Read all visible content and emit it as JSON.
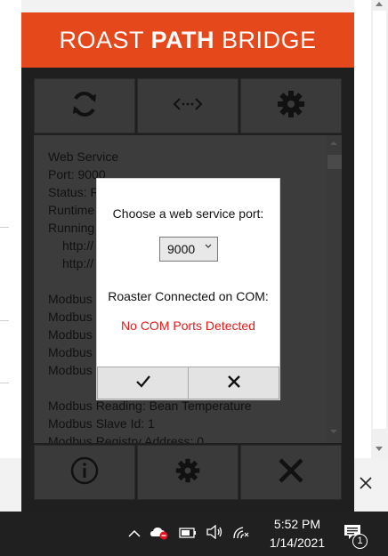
{
  "header": {
    "title_part1": "ROAST ",
    "title_part2": "PATH",
    "title_part3": " BRIDGE"
  },
  "toolbar": {
    "refresh_icon": "refresh-icon",
    "code_icon": "code-icon",
    "settings_icon": "gear-icon"
  },
  "status_lines": [
    "Web Service",
    "Port: 9000",
    "Status: R",
    "Runtime",
    "Running",
    "http://",
    "http://",
    "",
    "Modbus",
    "Modbus",
    "Modbus",
    "Modbus",
    "Modbus",
    "",
    "Modbus Reading: Bean Temperature",
    "Modbus Slave Id: 1",
    "Modbus Registry Address: 0"
  ],
  "dialog": {
    "prompt": "Choose a web service port:",
    "port_value": "9000",
    "roaster_label": "Roaster Connected on COM:",
    "error_text": "No COM Ports Detected",
    "ok_icon": "checkmark-icon",
    "cancel_icon": "close-icon",
    "error_color": "#e21b1b"
  },
  "bottombar": {
    "info_icon": "info-icon",
    "settings_icon": "gear-icon",
    "close_icon": "close-icon"
  },
  "taskbar": {
    "time": "5:52 PM",
    "date": "1/14/2021",
    "notification_count": "1"
  },
  "colors": {
    "accent": "#e5481b",
    "app_bg": "#1f1f1f",
    "panel": "#3c3c3c"
  }
}
